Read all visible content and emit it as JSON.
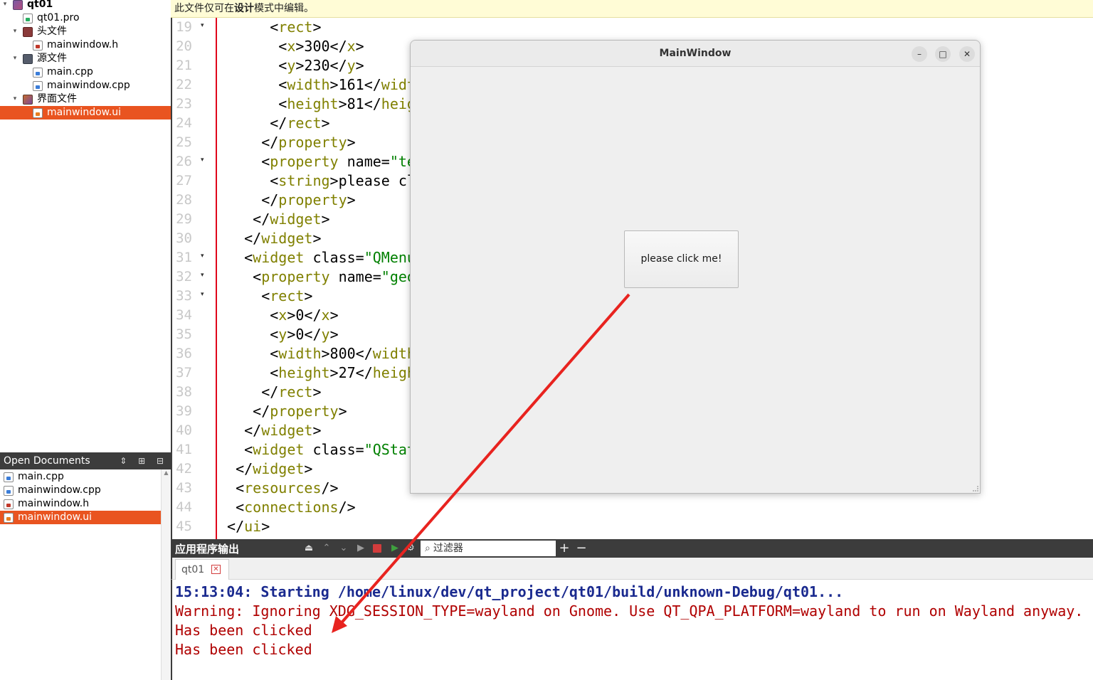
{
  "project_tree": {
    "items": [
      {
        "label": "qt01",
        "type": "project",
        "depth": 0,
        "expanded": true,
        "selected": false
      },
      {
        "label": "qt01.pro",
        "type": "pro",
        "depth": 1,
        "expanded": null,
        "selected": false
      },
      {
        "label": "头文件",
        "type": "folder-h",
        "depth": 1,
        "expanded": true,
        "selected": false
      },
      {
        "label": "mainwindow.h",
        "type": "h",
        "depth": 2,
        "expanded": null,
        "selected": false
      },
      {
        "label": "源文件",
        "type": "folder-s",
        "depth": 1,
        "expanded": true,
        "selected": false
      },
      {
        "label": "main.cpp",
        "type": "cpp",
        "depth": 2,
        "expanded": null,
        "selected": false
      },
      {
        "label": "mainwindow.cpp",
        "type": "cpp",
        "depth": 2,
        "expanded": null,
        "selected": false
      },
      {
        "label": "界面文件",
        "type": "folder-u",
        "depth": 1,
        "expanded": true,
        "selected": false
      },
      {
        "label": "mainwindow.ui",
        "type": "ui",
        "depth": 2,
        "expanded": null,
        "selected": true
      }
    ]
  },
  "open_documents": {
    "title": "Open Documents",
    "items": [
      {
        "label": "main.cpp",
        "type": "cpp",
        "selected": false
      },
      {
        "label": "mainwindow.cpp",
        "type": "cpp",
        "selected": false
      },
      {
        "label": "mainwindow.h",
        "type": "h",
        "selected": false
      },
      {
        "label": "mainwindow.ui",
        "type": "ui",
        "selected": true
      }
    ]
  },
  "editor": {
    "design_notice_prefix": "此文件仅可在",
    "design_notice_bold": "设计",
    "design_notice_suffix": "模式中编辑。",
    "lines": [
      {
        "n": "19",
        "fold": true,
        "segs": [
          [
            "t",
            "      <"
          ],
          [
            "g",
            "rect"
          ],
          [
            "t",
            ">"
          ]
        ]
      },
      {
        "n": "20",
        "fold": false,
        "segs": [
          [
            "t",
            "       <"
          ],
          [
            "g",
            "x"
          ],
          [
            "t",
            ">300</"
          ],
          [
            "g",
            "x"
          ],
          [
            "t",
            ">"
          ]
        ]
      },
      {
        "n": "21",
        "fold": false,
        "segs": [
          [
            "t",
            "       <"
          ],
          [
            "g",
            "y"
          ],
          [
            "t",
            ">230</"
          ],
          [
            "g",
            "y"
          ],
          [
            "t",
            ">"
          ]
        ]
      },
      {
        "n": "22",
        "fold": false,
        "segs": [
          [
            "t",
            "       <"
          ],
          [
            "g",
            "width"
          ],
          [
            "t",
            ">161</"
          ],
          [
            "g",
            "width"
          ],
          [
            "t",
            ">"
          ]
        ]
      },
      {
        "n": "23",
        "fold": false,
        "segs": [
          [
            "t",
            "       <"
          ],
          [
            "g",
            "height"
          ],
          [
            "t",
            ">81</"
          ],
          [
            "g",
            "height"
          ],
          [
            "t",
            ">"
          ]
        ]
      },
      {
        "n": "24",
        "fold": false,
        "segs": [
          [
            "t",
            "      </"
          ],
          [
            "g",
            "rect"
          ],
          [
            "t",
            ">"
          ]
        ]
      },
      {
        "n": "25",
        "fold": false,
        "segs": [
          [
            "t",
            "     </"
          ],
          [
            "g",
            "property"
          ],
          [
            "t",
            ">"
          ]
        ]
      },
      {
        "n": "26",
        "fold": true,
        "segs": [
          [
            "t",
            "     <"
          ],
          [
            "g",
            "property"
          ],
          [
            "t",
            " name="
          ],
          [
            "s",
            "\"text\""
          ],
          [
            "t",
            ">"
          ]
        ]
      },
      {
        "n": "27",
        "fold": false,
        "segs": [
          [
            "t",
            "      <"
          ],
          [
            "g",
            "string"
          ],
          [
            "t",
            ">please click me!</"
          ],
          [
            "g",
            "string"
          ],
          [
            "t",
            ">"
          ]
        ]
      },
      {
        "n": "28",
        "fold": false,
        "segs": [
          [
            "t",
            "     </"
          ],
          [
            "g",
            "property"
          ],
          [
            "t",
            ">"
          ]
        ]
      },
      {
        "n": "29",
        "fold": false,
        "segs": [
          [
            "t",
            "    </"
          ],
          [
            "g",
            "widget"
          ],
          [
            "t",
            ">"
          ]
        ]
      },
      {
        "n": "30",
        "fold": false,
        "segs": [
          [
            "t",
            "   </"
          ],
          [
            "g",
            "widget"
          ],
          [
            "t",
            ">"
          ]
        ]
      },
      {
        "n": "31",
        "fold": true,
        "segs": [
          [
            "t",
            "   <"
          ],
          [
            "g",
            "widget"
          ],
          [
            "t",
            " class="
          ],
          [
            "s",
            "\"QMenuBar\""
          ],
          [
            "t",
            ">"
          ]
        ]
      },
      {
        "n": "32",
        "fold": true,
        "segs": [
          [
            "t",
            "    <"
          ],
          [
            "g",
            "property"
          ],
          [
            "t",
            " name="
          ],
          [
            "s",
            "\"geometry\""
          ],
          [
            "t",
            ">"
          ]
        ]
      },
      {
        "n": "33",
        "fold": true,
        "segs": [
          [
            "t",
            "     <"
          ],
          [
            "g",
            "rect"
          ],
          [
            "t",
            ">"
          ]
        ]
      },
      {
        "n": "34",
        "fold": false,
        "segs": [
          [
            "t",
            "      <"
          ],
          [
            "g",
            "x"
          ],
          [
            "t",
            ">0</"
          ],
          [
            "g",
            "x"
          ],
          [
            "t",
            ">"
          ]
        ]
      },
      {
        "n": "35",
        "fold": false,
        "segs": [
          [
            "t",
            "      <"
          ],
          [
            "g",
            "y"
          ],
          [
            "t",
            ">0</"
          ],
          [
            "g",
            "y"
          ],
          [
            "t",
            ">"
          ]
        ]
      },
      {
        "n": "36",
        "fold": false,
        "segs": [
          [
            "t",
            "      <"
          ],
          [
            "g",
            "width"
          ],
          [
            "t",
            ">800</"
          ],
          [
            "g",
            "width"
          ],
          [
            "t",
            ">"
          ]
        ]
      },
      {
        "n": "37",
        "fold": false,
        "segs": [
          [
            "t",
            "      <"
          ],
          [
            "g",
            "height"
          ],
          [
            "t",
            ">27</"
          ],
          [
            "g",
            "height"
          ],
          [
            "t",
            ">"
          ]
        ]
      },
      {
        "n": "38",
        "fold": false,
        "segs": [
          [
            "t",
            "     </"
          ],
          [
            "g",
            "rect"
          ],
          [
            "t",
            ">"
          ]
        ]
      },
      {
        "n": "39",
        "fold": false,
        "segs": [
          [
            "t",
            "    </"
          ],
          [
            "g",
            "property"
          ],
          [
            "t",
            ">"
          ]
        ]
      },
      {
        "n": "40",
        "fold": false,
        "segs": [
          [
            "t",
            "   </"
          ],
          [
            "g",
            "widget"
          ],
          [
            "t",
            ">"
          ]
        ]
      },
      {
        "n": "41",
        "fold": false,
        "segs": [
          [
            "t",
            "   <"
          ],
          [
            "g",
            "widget"
          ],
          [
            "t",
            " class="
          ],
          [
            "s",
            "\"QStatusBar\""
          ],
          [
            "t",
            ">"
          ]
        ]
      },
      {
        "n": "42",
        "fold": false,
        "segs": [
          [
            "t",
            "  </"
          ],
          [
            "g",
            "widget"
          ],
          [
            "t",
            ">"
          ]
        ]
      },
      {
        "n": "43",
        "fold": false,
        "segs": [
          [
            "t",
            "  <"
          ],
          [
            "g",
            "resources"
          ],
          [
            "t",
            "/>"
          ]
        ]
      },
      {
        "n": "44",
        "fold": false,
        "segs": [
          [
            "t",
            "  <"
          ],
          [
            "g",
            "connections"
          ],
          [
            "t",
            "/>"
          ]
        ]
      },
      {
        "n": "45",
        "fold": false,
        "segs": [
          [
            "t",
            " </"
          ],
          [
            "g",
            "ui"
          ],
          [
            "t",
            ">"
          ]
        ]
      }
    ]
  },
  "main_window": {
    "title": "MainWindow",
    "min_symbol": "–",
    "max_symbol": "□",
    "close_symbol": "✕",
    "button_label": "please click me!"
  },
  "output": {
    "title": "应用程序输出",
    "filter_placeholder": "过滤器",
    "plus_symbol": "+",
    "minus_symbol": "−",
    "tab_label": "qt01",
    "lines": [
      {
        "kind": "start",
        "text": "15:13:04: Starting /home/linux/dev/qt_project/qt01/build/unknown-Debug/qt01..."
      },
      {
        "kind": "warn",
        "text": "Warning: Ignoring XDG_SESSION_TYPE=wayland on Gnome. Use QT_QPA_PLATFORM=wayland to run on Wayland anyway."
      },
      {
        "kind": "warn",
        "text": "Has been clicked"
      },
      {
        "kind": "warn",
        "text": "Has been clicked"
      }
    ]
  },
  "colors": {
    "selection": "#e95420",
    "annotation_arrow": "#e8231f",
    "xml_tag": "#808000",
    "xml_string": "#008000",
    "output_start": "#1a2a8f",
    "output_error": "#b00000"
  }
}
